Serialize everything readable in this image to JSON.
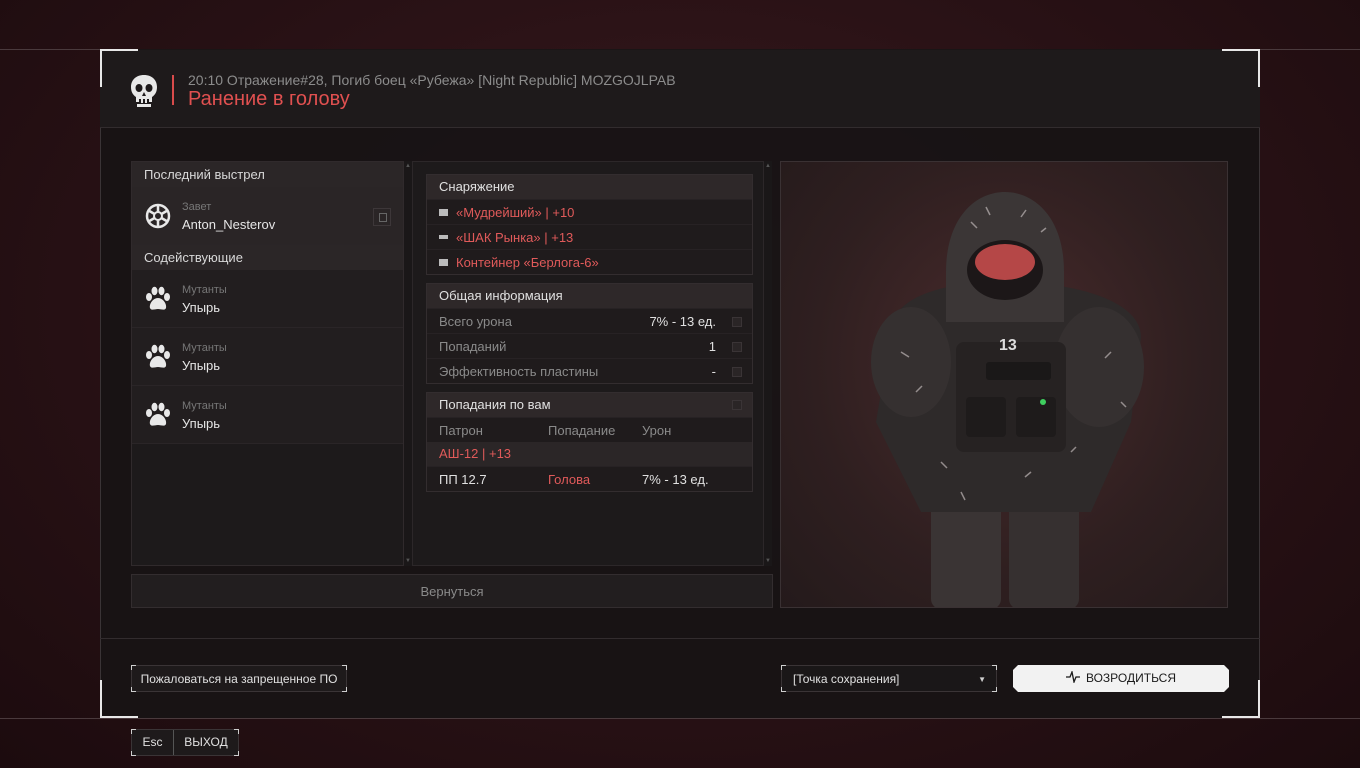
{
  "header": {
    "subtitle": "20:10 Отражение#28, Погиб боец «Рубежа» [Night Republic] MOZGOJLPAB",
    "title": "Ранение в голову",
    "skull_icon": "skull-icon"
  },
  "left": {
    "last_shot_label": "Последний выстрел",
    "killer": {
      "faction": "Завет",
      "name": "Anton_Nesterov",
      "icon": "faction-emblem-icon"
    },
    "assists_label": "Содействующие",
    "assists": [
      {
        "faction": "Мутанты",
        "name": "Упырь",
        "icon": "paw-icon"
      },
      {
        "faction": "Мутанты",
        "name": "Упырь",
        "icon": "paw-icon"
      },
      {
        "faction": "Мутанты",
        "name": "Упырь",
        "icon": "paw-icon"
      }
    ]
  },
  "equipment": {
    "label": "Снаряжение",
    "items": [
      {
        "text": "«Мудрейший» | +10",
        "icon": "armor-icon"
      },
      {
        "text": "«ШАК Рынка» | +13",
        "icon": "gun-icon"
      },
      {
        "text": "Контейнер «Берлога-6»",
        "icon": "container-icon"
      }
    ]
  },
  "general": {
    "label": "Общая информация",
    "rows": [
      {
        "label": "Всего урона",
        "value": "7% - 13 ед."
      },
      {
        "label": "Попаданий",
        "value": "1"
      },
      {
        "label": "Эффективность пластины",
        "value": "-"
      }
    ]
  },
  "hits": {
    "label": "Попадания по вам",
    "columns": [
      "Патрон",
      "Попадание",
      "Урон"
    ],
    "weapon": "АШ-12 | +13",
    "rows": [
      {
        "ammo": "ПП 12.7",
        "location": "Голова",
        "damage": "7% - 13 ед."
      }
    ]
  },
  "back_label": "Вернуться",
  "bottom": {
    "report_label": "Пожаловаться на запрещенное ПО",
    "spawn_select": "[Точка сохранения]",
    "respawn_label": "ВОЗРОДИТЬСЯ",
    "esc_key": "Esc",
    "exit_label": "ВЫХОД"
  },
  "colors": {
    "accent_red": "#e05050",
    "background": "#2a1216",
    "panel": "#1d1a1b"
  }
}
